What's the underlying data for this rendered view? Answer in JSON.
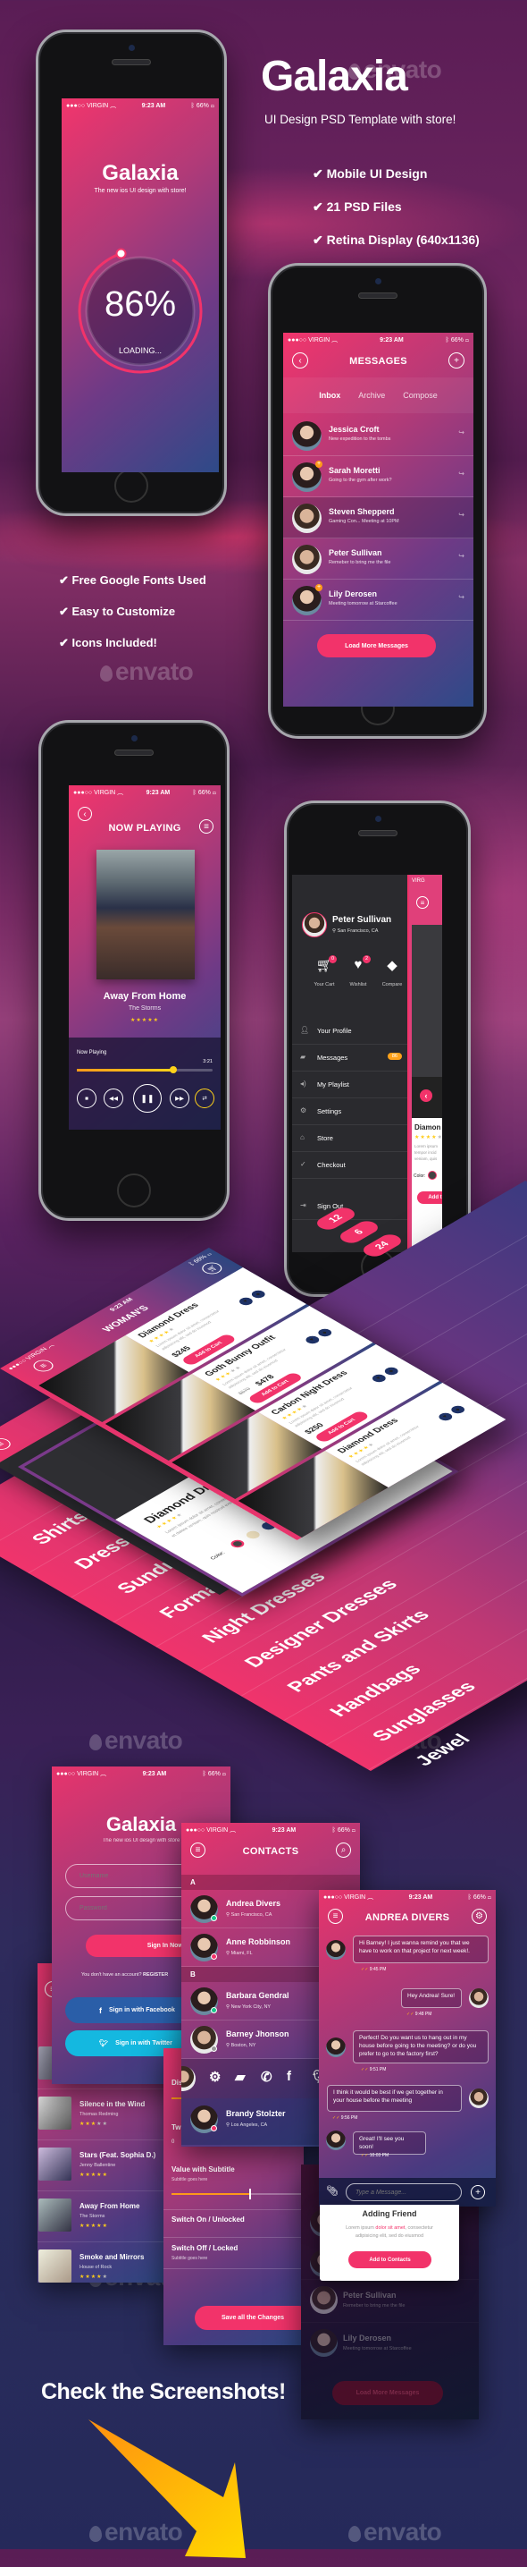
{
  "watermark": "envato",
  "hero": {
    "title": "Galaxia",
    "subtitle": "UI Design PSD Template with store!",
    "features": [
      "Mobile UI Design",
      "21 PSD Files",
      "Retina Display (640x1136)"
    ]
  },
  "features2": [
    "Free Google Fonts Used",
    "Easy to Customize",
    "Icons Included!"
  ],
  "colors": {
    "accent": "#f2336a",
    "navy": "#1e3266",
    "star": "#ffcc1a",
    "online": "#18c48a"
  },
  "status": {
    "carrier": "VIRGIN",
    "time": "9:23 AM",
    "battery": "66%"
  },
  "loading": {
    "title": "Galaxia",
    "tagline": "The new ios UI design with store!",
    "percent": "86%",
    "progress": 86,
    "label": "LOADING..."
  },
  "messages": {
    "title": "MESSAGES",
    "tabs": [
      "Inbox",
      "Archive",
      "Compose"
    ],
    "active_tab": "Inbox",
    "items": [
      {
        "name": "Jessica Croft",
        "preview": "New expedition to the tombs"
      },
      {
        "name": "Sarah Moretti",
        "preview": "Going to the gym after work?",
        "new": true
      },
      {
        "name": "Steven Shepperd",
        "preview": "Gaming Con... Meeting at 10PM"
      },
      {
        "name": "Peter Sullivan",
        "preview": "Remeber to bring me the file"
      },
      {
        "name": "Lily Derosen",
        "preview": "Meeting tomorrow at Starcoffee",
        "new": true
      }
    ],
    "button": "Load More Messages"
  },
  "player": {
    "title": "NOW PLAYING",
    "song": "Away From Home",
    "artist": "The Storms",
    "rating": 5,
    "bar_label": "Now Playing",
    "duration": "3:21",
    "progress": 0.71
  },
  "profile": {
    "name": "Peter Sullivan",
    "location": "San Francisco, CA",
    "shortcuts": [
      {
        "label": "Your Cart",
        "badge": "0"
      },
      {
        "label": "Wishlist",
        "badge": "2"
      },
      {
        "label": "Compare"
      }
    ],
    "menu": [
      {
        "label": "Your Profile",
        "icon": "user-icon"
      },
      {
        "label": "Messages",
        "icon": "chat-icon",
        "badge": "86"
      },
      {
        "label": "My Playlist",
        "icon": "speaker-icon"
      },
      {
        "label": "Settings",
        "icon": "gear-icon"
      },
      {
        "label": "Store",
        "icon": "store-icon"
      },
      {
        "label": "Checkout",
        "icon": "check-icon"
      },
      {
        "label": "Sign Out",
        "icon": "sign-out-icon"
      }
    ],
    "peek": {
      "carrier": "VIRG",
      "product": "Diamon",
      "desc": "Lorem ipsum tempor incid veniam, quis",
      "color_label": "Color:",
      "button": "Add t"
    }
  },
  "store": {
    "title": "WOMAN'S",
    "back_title": "WO",
    "products": [
      {
        "name": "Diamond Dress",
        "price": "$245",
        "rating": 4
      },
      {
        "name": "Goth Bunny Outfit",
        "old_price": "$570",
        "price": "$478",
        "rating": 3
      },
      {
        "name": "Carbon Night Dress",
        "price": "$250",
        "rating": 4
      },
      {
        "name": "Diamond Dress",
        "rating": 4
      }
    ],
    "desc": "Lorem ipsum dolor sit amet, consectetur adipisicing elit, sed do eiusmod",
    "add_to_cart": "Add to Cart",
    "detail": {
      "name": "Diamond Dress",
      "rating": 4,
      "desc": "Lorem ipsum dolor sit amet, consectetur tempor incididunt ut labore et dolore veniam, quis nostrud exercitation",
      "size_label": "Size:",
      "sizes": [
        "S",
        "M",
        "L"
      ],
      "color_label": "Color:",
      "button": "Add to Cart"
    },
    "categories": [
      "Shirts",
      "Dresses",
      "Sundress",
      "Formal D",
      "Night Dresses",
      "Designer Dresses",
      "Pants and Skirts",
      "Handbags",
      "Sunglasses",
      "Jewel"
    ],
    "counts": [
      "12",
      "6",
      "24"
    ]
  },
  "login": {
    "title": "Galaxia",
    "tagline": "The new ios UI design with store",
    "username_placeholder": "Username",
    "password_placeholder": "Password",
    "signin": "Sign In Now!",
    "register_prompt": "You don't have an account?",
    "register": "REGISTER",
    "facebook": "Sign in with Facebook",
    "twitter": "Sign in with Twitter"
  },
  "playlist": [
    {
      "title": "Silence in the Wind",
      "artist": "Thomas Redming",
      "rating": 3
    },
    {
      "title": "Stars (Feat. Sophia D.)",
      "artist": "Jenny Ballentine",
      "rating": 5
    },
    {
      "title": "Away From Home",
      "artist": "The Storms",
      "rating": 5
    },
    {
      "title": "Smoke and Mirrors",
      "artist": "House of Rock",
      "rating": 4
    }
  ],
  "settings": {
    "rows": [
      {
        "label": "Dis"
      },
      {
        "label": "Tw",
        "value": "0"
      },
      {
        "label": "Value with Subtitle",
        "subtitle": "Subtitle goes here",
        "value": 0.6
      },
      {
        "label": "Switch On / Unlocked"
      },
      {
        "label": "Switch Off / Locked",
        "subtitle": "Subtitle goes here"
      }
    ],
    "button": "Save all the Changes"
  },
  "contacts": {
    "title": "CONTACTS",
    "sections": [
      {
        "letter": "A",
        "items": [
          {
            "name": "Andrea Divers",
            "location": "San Francisco, CA",
            "status": "online"
          },
          {
            "name": "Anne Robbinson",
            "location": "Miami, FL",
            "status": "busy"
          }
        ]
      },
      {
        "letter": "B",
        "items": [
          {
            "name": "Barbara Gendral",
            "location": "New York City, NY",
            "status": "online"
          },
          {
            "name": "Barney Jhonson",
            "location": "Boston, NY",
            "status": "offline"
          }
        ]
      }
    ],
    "actions": [
      "gear-icon",
      "chat-icon",
      "phone-icon",
      "facebook-icon",
      "twitter-icon"
    ],
    "last": {
      "name": "Brandy Stolzter",
      "location": "Los Angeles, CA",
      "status": "busy"
    }
  },
  "chat": {
    "title": "ANDREA DIVERS",
    "messages": [
      {
        "from": "them",
        "text": "Hi Barney! I just wanna remind you that we have to work on that project for next week!.",
        "time": "9:45 PM"
      },
      {
        "from": "me",
        "text": "Hey Andrea! Sure!",
        "time": "9:48 PM"
      },
      {
        "from": "them",
        "text": "Perfect! Do you want us to hang out in my house before going to the meeting? or do you prefer to go to the factory first?",
        "time": "9:51 PM"
      },
      {
        "from": "me",
        "text": "I think it would be best if we get together in your house before the meeting",
        "time": "9:56 PM"
      },
      {
        "from": "them",
        "text": "Great! I'll see you soon!",
        "time": "10:03 PM"
      }
    ],
    "input_placeholder": "Type a Message..."
  },
  "modal": {
    "title": "Adding Friend",
    "text_before": "Lorem ipsum ",
    "text_highlight": "dolor sit amet",
    "text_after": ", consectetur adipisicing elit, sed do eiusmod",
    "button": "Add to Contacts"
  },
  "dim_list": {
    "items": [
      {
        "name": "Peter Sullivan",
        "preview": "Remeber to bring me the file"
      },
      {
        "name": "Lily Derosen",
        "preview": "Meeting tomorrow at Starcoffee"
      }
    ],
    "button": "Load More Messages"
  },
  "cta": "Check the Screenshots!"
}
